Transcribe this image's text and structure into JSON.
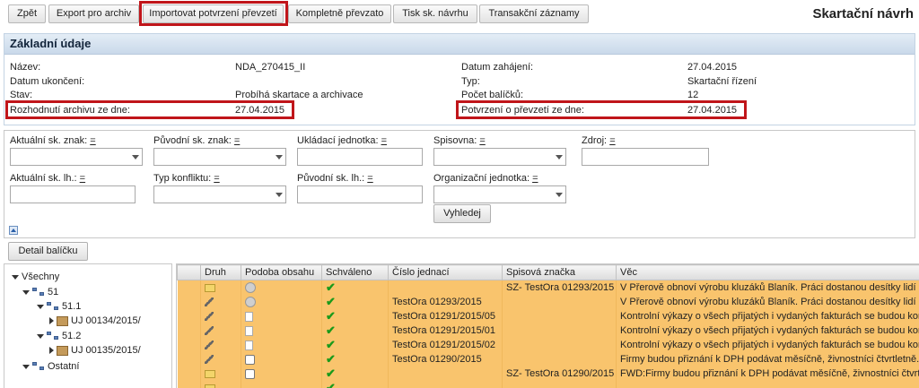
{
  "toolbar": {
    "buttons": [
      "Zpět",
      "Export pro archiv",
      "Importovat potvrzení převzetí",
      "Kompletně převzato",
      "Tisk sk. návrhu",
      "Transakční záznamy"
    ]
  },
  "page_title": "Skartační návrh",
  "basic": {
    "header": "Základní údaje",
    "left": [
      {
        "label": "Název:",
        "value": "NDA_270415_II"
      },
      {
        "label": "Datum ukončení:",
        "value": ""
      },
      {
        "label": "Stav:",
        "value": "Probíhá skartace a archivace"
      },
      {
        "label": "Rozhodnutí archivu ze dne:",
        "value": "27.04.2015"
      }
    ],
    "right": [
      {
        "label": "Datum zahájení:",
        "value": "27.04.2015"
      },
      {
        "label": "Typ:",
        "value": "Skartační řízení"
      },
      {
        "label": "Počet balíčků:",
        "value": "12"
      },
      {
        "label": "Potvrzení o převzetí ze dne:",
        "value": "27.04.2015"
      }
    ]
  },
  "filters": {
    "row1": [
      "Aktuální sk. znak:",
      "Původní sk. znak:",
      "Ukládací jednotka:",
      "Spisovna:",
      "Zdroj:"
    ],
    "row2": [
      "Aktuální sk. lh.:",
      "Typ konfliktu:",
      "Původní sk. lh.:",
      "Organizační jednotka:"
    ],
    "op": "=",
    "search_button": "Vyhledej"
  },
  "detail_button": "Detail balíčku",
  "tree": {
    "root": "Všechny",
    "n51": "51",
    "n511": "51.1",
    "uj1": "UJ 00134/2015/",
    "n512": "51.2",
    "uj2": "UJ 00135/2015/",
    "other": "Ostatní"
  },
  "grid": {
    "columns": [
      "Druh",
      "Podoba obsahu",
      "Schváleno",
      "Číslo jednací",
      "Spisová značka",
      "Věc"
    ],
    "rows": [
      {
        "druh": "folder",
        "podoba": "cd",
        "cj": "",
        "sz": "SZ- TestOra 01293/2015",
        "vec": "V Přerově obnoví výrobu kluzáků Blaník. Práci dostanou desítky lidí"
      },
      {
        "druh": "pencil",
        "podoba": "cd",
        "cj": "TestOra 01293/2015",
        "sz": "",
        "vec": "V Přerově obnoví výrobu kluzáků Blaník. Práci dostanou desítky lidí"
      },
      {
        "druh": "pencil",
        "podoba": "doc",
        "cj": "TestOra 01291/2015/05",
        "sz": "",
        "vec": "Kontrolní výkazy o všech přijatých i vydaných fakturách se budou kon"
      },
      {
        "druh": "pencil",
        "podoba": "doc",
        "cj": "TestOra 01291/2015/01",
        "sz": "",
        "vec": "Kontrolní výkazy o všech přijatých i vydaných fakturách se budou kon"
      },
      {
        "druh": "pencil",
        "podoba": "doc",
        "cj": "TestOra 01291/2015/02",
        "sz": "",
        "vec": "Kontrolní výkazy o všech přijatých i vydaných fakturách se budou kon"
      },
      {
        "druh": "pencil",
        "podoba": "clock",
        "cj": "TestOra 01290/2015",
        "sz": "",
        "vec": "Firmy budou přiznání k DPH podávat měsíčně, živnostníci čtvrtletně."
      },
      {
        "druh": "folder",
        "podoba": "clock",
        "cj": "",
        "sz": "SZ- TestOra 01290/2015",
        "vec": "FWD:Firmy budou přiznání k DPH podávat měsíčně, živnostníci čtvrtl"
      },
      {
        "druh": "folder",
        "podoba": "",
        "cj": "",
        "sz": "",
        "vec": ""
      }
    ]
  },
  "colors": {
    "highlight": "#c0151a",
    "row_bg": "#f9c46d",
    "header_bg": "#c9d9ea",
    "check": "#1a9a1a"
  }
}
